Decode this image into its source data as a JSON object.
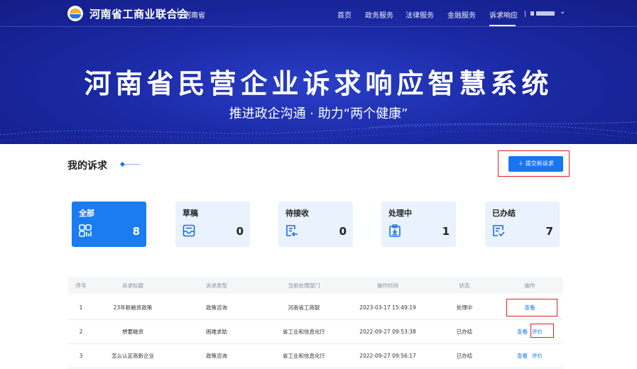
{
  "header": {
    "org_name": "河南省工商业联合会",
    "region": "河南省",
    "nav": [
      "首页",
      "政务服务",
      "法律服务",
      "金融服务",
      "诉求响应"
    ],
    "active_nav": "诉求响应",
    "hero_title": "河南省民营企业诉求响应智慧系统",
    "hero_subtitle": "推进政企沟通 · 助力“两个健康”"
  },
  "section": {
    "title": "我的诉求",
    "submit_label": "＋ 提交新诉求"
  },
  "stats": [
    {
      "label": "全部",
      "count": "8",
      "icon": "grid-apps-icon",
      "active": true
    },
    {
      "label": "草稿",
      "count": "0",
      "icon": "inbox-tray-icon",
      "active": false
    },
    {
      "label": "待接收",
      "count": "0",
      "icon": "document-receive-icon",
      "active": false
    },
    {
      "label": "处理中",
      "count": "1",
      "icon": "clipboard-download-icon",
      "active": false
    },
    {
      "label": "已办结",
      "count": "7",
      "icon": "document-check-icon",
      "active": false
    }
  ],
  "table": {
    "headers": [
      "序号",
      "诉求标题",
      "诉求类型",
      "当前处理部门",
      "操作时间",
      "状态",
      "操作"
    ],
    "rows": [
      {
        "no": "1",
        "title": "23年新融资政策",
        "type": "政策咨询",
        "dept": "河南省工商联",
        "time": "2023-03-17 15:49:19",
        "status": "处理中",
        "ops": [
          "查看"
        ]
      },
      {
        "no": "2",
        "title": "想要融资",
        "type": "困难求助",
        "dept": "省工业和信息化厅",
        "time": "2022-09-27 09:53:38",
        "status": "已办结",
        "ops": [
          "查看",
          "评价"
        ]
      },
      {
        "no": "3",
        "title": "怎么认定高新企业",
        "type": "政策咨询",
        "dept": "省工业和信息化厅",
        "time": "2022-09-27 09:56:17",
        "status": "已办结",
        "ops": [
          "查看",
          "评价"
        ]
      }
    ]
  },
  "colors": {
    "banner": "#1b2aa6",
    "accent": "#1a76f0",
    "card_bg": "#e9f2fd",
    "highlight": "#e02020"
  }
}
